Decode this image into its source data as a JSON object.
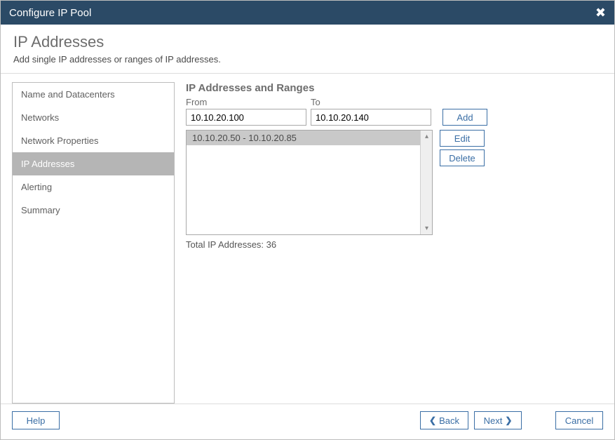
{
  "titlebar": {
    "title": "Configure IP Pool"
  },
  "header": {
    "title": "IP Addresses",
    "subtitle": "Add single IP addresses or ranges of IP addresses."
  },
  "sidebar": {
    "items": [
      {
        "label": "Name and Datacenters",
        "active": false
      },
      {
        "label": "Networks",
        "active": false
      },
      {
        "label": "Network Properties",
        "active": false
      },
      {
        "label": "IP Addresses",
        "active": true
      },
      {
        "label": "Alerting",
        "active": false
      },
      {
        "label": "Summary",
        "active": false
      }
    ]
  },
  "main": {
    "section_title": "IP Addresses and Ranges",
    "from_label": "From",
    "to_label": "To",
    "from_value": "10.10.20.100",
    "to_value": "10.10.20.140",
    "add_label": "Add",
    "edit_label": "Edit",
    "delete_label": "Delete",
    "listbox": {
      "items": [
        {
          "label": "10.10.20.50 - 10.10.20.85",
          "selected": true
        }
      ]
    },
    "total_label": "Total IP Addresses: 36"
  },
  "footer": {
    "help_label": "Help",
    "back_label": "Back",
    "next_label": "Next",
    "cancel_label": "Cancel"
  }
}
